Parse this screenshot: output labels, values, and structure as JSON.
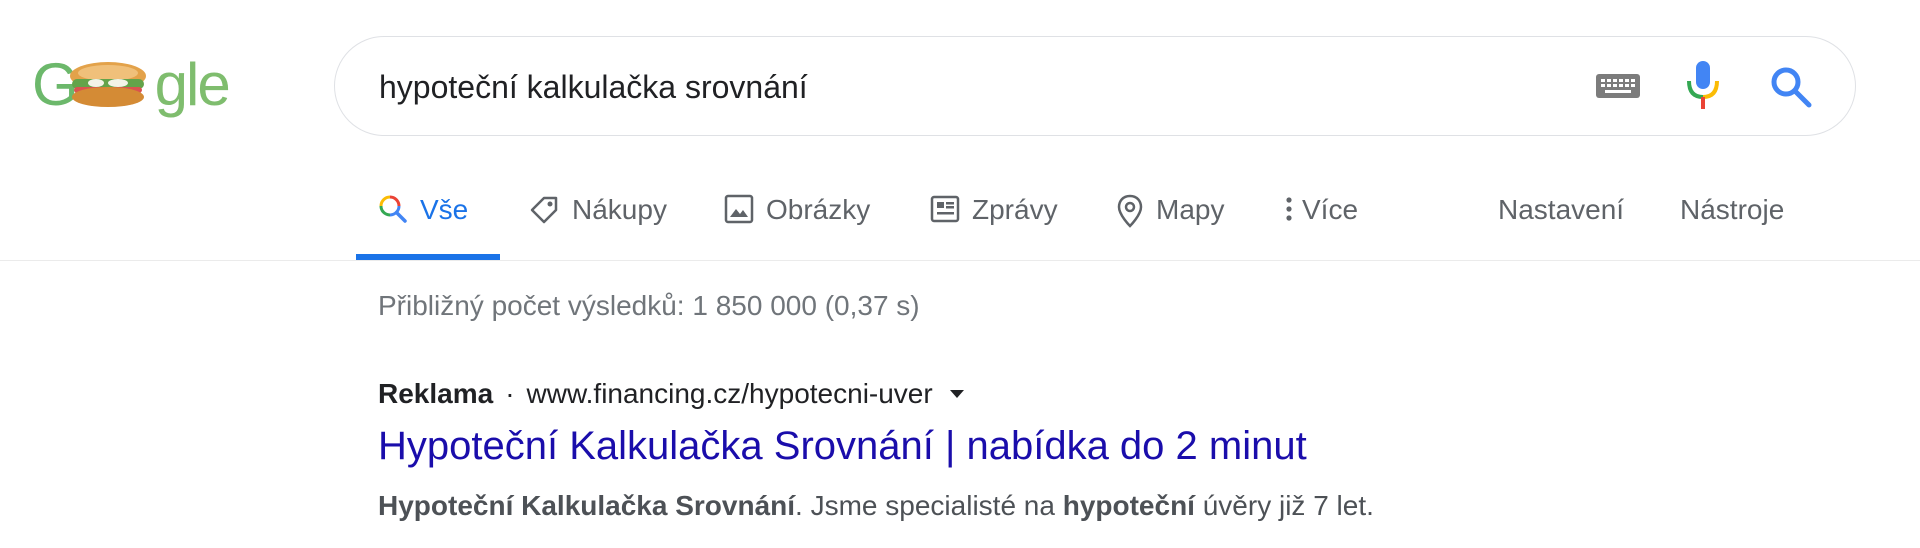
{
  "logo": {
    "text_g": "G",
    "text_rest": "gle",
    "alt": "Google"
  },
  "search": {
    "query": "hypoteční kalkulačka srovnání"
  },
  "tabs": [
    {
      "label": "Vše",
      "icon": "search-icon",
      "active": true
    },
    {
      "label": "Nákupy",
      "icon": "tag-icon"
    },
    {
      "label": "Obrázky",
      "icon": "image-icon"
    },
    {
      "label": "Zprávy",
      "icon": "news-icon"
    },
    {
      "label": "Mapy",
      "icon": "map-pin-icon"
    },
    {
      "label": "Více",
      "icon": "more-vert-icon"
    }
  ],
  "tools": {
    "settings": "Nastavení",
    "tools": "Nástroje"
  },
  "stats": "Přibližný počet výsledků: 1 850 000 (0,37 s)",
  "ad": {
    "label": "Reklama",
    "separator": "·",
    "url": "www.financing.cz/hypotecni-uver",
    "title": "Hypoteční Kalkulačka Srovnání | nabídka do 2 minut",
    "desc_bold_1": "Hypoteční Kalkulačka Srovnání",
    "desc_text_1": ". Jsme specialisté na ",
    "desc_bold_2": "hypoteční",
    "desc_text_2": " úvěry již 7 let."
  },
  "colors": {
    "accent": "#1a73e8",
    "link": "#1a0dab",
    "muted": "#70757a"
  }
}
